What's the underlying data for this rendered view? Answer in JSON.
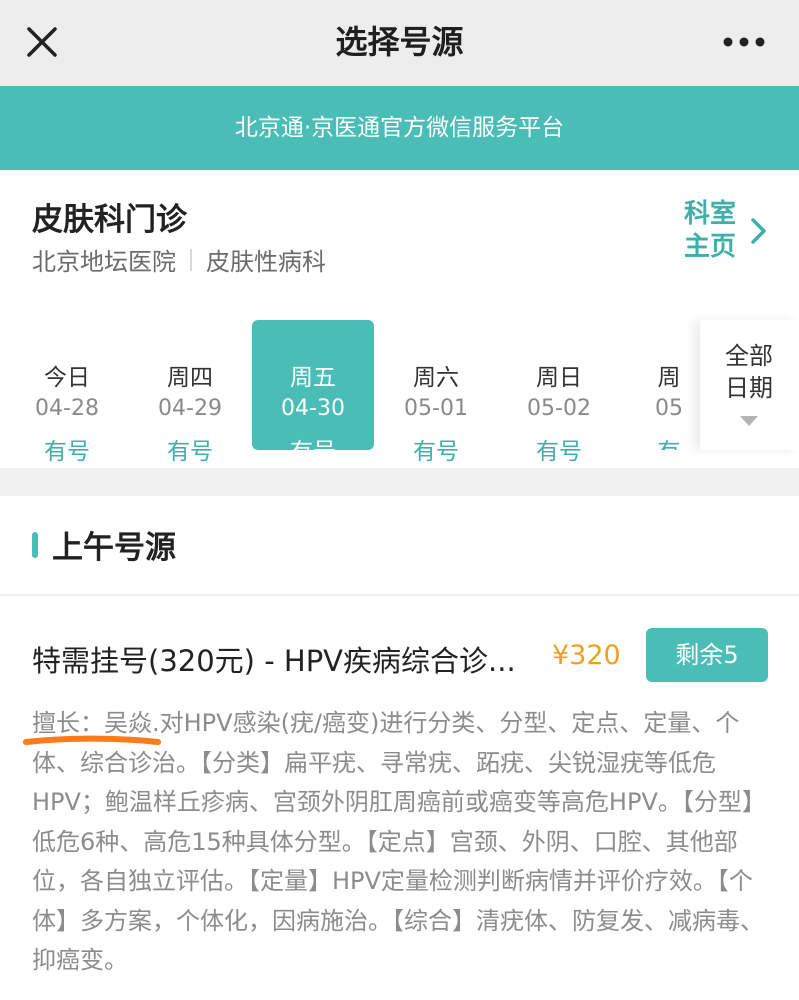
{
  "navbar": {
    "title": "选择号源",
    "close_icon": "close-icon",
    "more_icon": "more-icon"
  },
  "banner": {
    "text": "北京通·京医通官方微信服务平台"
  },
  "department": {
    "name": "皮肤科门诊",
    "hospital": "北京地坛医院",
    "division": "皮肤性病科",
    "home_link": "科室主页"
  },
  "dates": [
    {
      "weekday": "今日",
      "date": "04-28",
      "status": "有号"
    },
    {
      "weekday": "周四",
      "date": "04-29",
      "status": "有号"
    },
    {
      "weekday": "周五",
      "date": "04-30",
      "status": "有号",
      "selected": true
    },
    {
      "weekday": "周六",
      "date": "05-01",
      "status": "有号"
    },
    {
      "weekday": "周日",
      "date": "05-02",
      "status": "有号"
    },
    {
      "weekday": "周",
      "date": "05",
      "status": "有"
    }
  ],
  "all_dates": {
    "label": "全部日期"
  },
  "section": {
    "title": "上午号源"
  },
  "ticket": {
    "title": "特需挂号(320元) - HPV疾病综合诊...",
    "price": "¥320",
    "remaining": "剩余5",
    "description": "擅长：吴焱.对HPV感染(疣/癌变)进行分类、分型、定点、定量、个体、综合诊治。【分类】扁平疣、寻常疣、跖疣、尖锐湿疣等低危HPV；鲍温样丘疹病、宫颈外阴肛周癌前或癌变等高危HPV。【分型】低危6种、高危15种具体分型。【定点】宫颈、外阴、口腔、其他部位，各自独立评估。【定量】HPV定量检测判断病情并评价疗效。【个体】多方案，个体化，因病施治。【综合】清疣体、防复发、减病毒、抑癌变。"
  },
  "colors": {
    "accent": "#4bbdb7",
    "accent_text": "#3fb0a9",
    "price": "#f0a020",
    "annotation": "#ff7a1a"
  }
}
